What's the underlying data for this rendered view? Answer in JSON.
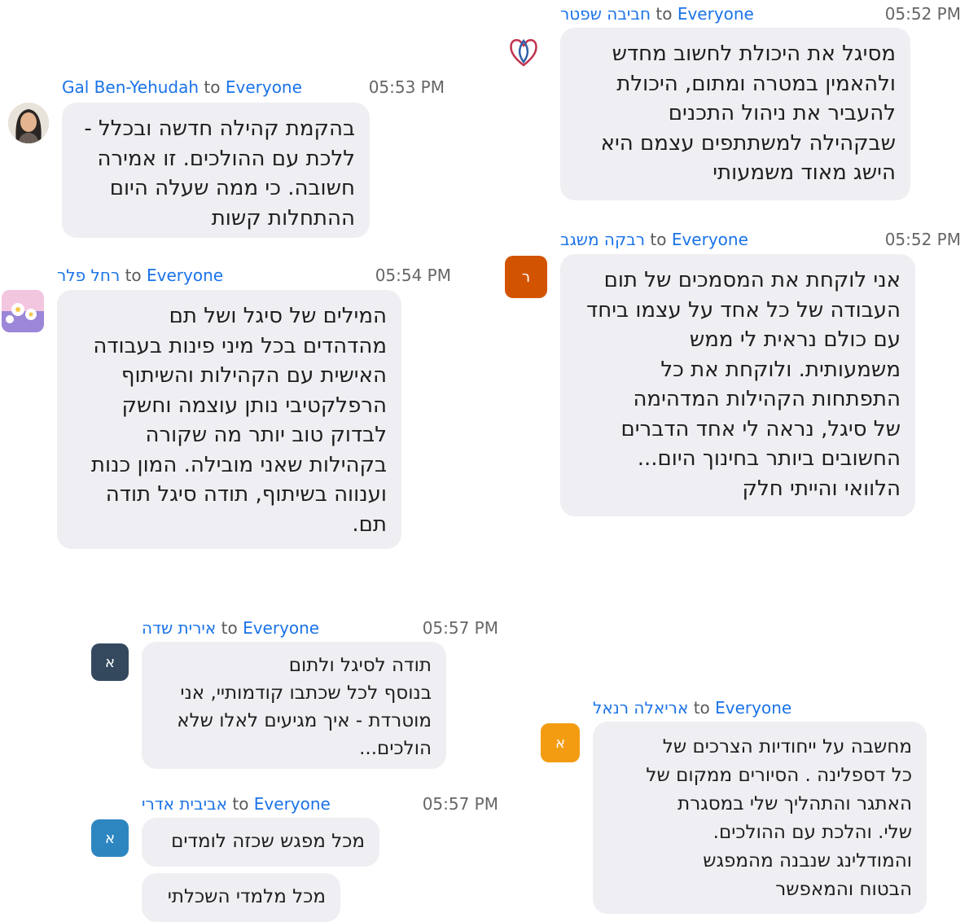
{
  "to_word": "to",
  "to_target": "Everyone",
  "messages": [
    {
      "sender": "חביבה שפטר",
      "time": "05:52 PM",
      "lines": [
        "מסיגל את היכולת לחשוב מחדש",
        "ולהאמין במטרה ומתום, היכולת",
        "להעביר את ניהול התכנים",
        "שבקהילה למשתתפים עצמם היא",
        "הישג מאוד משמעותי"
      ]
    },
    {
      "sender": "Gal Ben-Yehudah",
      "time": "05:53 PM",
      "lines": [
        "בהקמת קהילה חדשה ובכלל -",
        "ללכת עם ההולכים. זו אמירה",
        "חשובה. כי ממה שעלה היום",
        "ההתחלות קשות"
      ]
    },
    {
      "sender": "רבקה משגב",
      "time": "05:52 PM",
      "avatar_letter": "ר",
      "lines": [
        "אני לוקחת את המסמכים של תום",
        "העבודה של כל אחד על עצמו ביחד",
        "עם כולם נראית לי ממש",
        "משמעותית. ולוקחת את כל",
        "התפתחות הקהילות המדהימה",
        "של סיגל, נראה לי אחד הדברים",
        "החשובים ביותר בחינוך היום...",
        "הלוואי והייתי חלק"
      ]
    },
    {
      "sender": "רחל פלר",
      "time": "05:54 PM",
      "lines": [
        "המילים של סיגל ושל תם",
        "מהדהדים בכל מיני פינות בעבודה",
        "האישית עם הקהילות והשיתוף",
        "הרפלקטיבי נותן עוצמה וחשק",
        "לבדוק טוב יותר מה שקורה",
        "בקהילות שאני מובילה. המון כנות",
        "וענווה בשיתוף, תודה סיגל תודה",
        "תם."
      ]
    },
    {
      "sender": "אירית שדה",
      "time": "05:57 PM",
      "avatar_letter": "א",
      "lines": [
        "תודה לסיגל ולתום",
        "בנוסף לכל שכתבו קודמותיי, אני",
        "מוטרדת - איך מגיעים לאלו שלא",
        "הולכים..."
      ]
    },
    {
      "sender": "אביבית אדרי",
      "time": "05:57 PM",
      "avatar_letter": "א",
      "lines": [
        "מכל מפגש שכזה לומדים"
      ],
      "lines2": [
        "מכל מלמדי השכלתי"
      ]
    },
    {
      "sender": "אריאלה רנאל",
      "avatar_letter": "א",
      "lines": [
        "מחשבה על ייחודיות הצרכים של",
        "כל דספלינה . הסיורים ממקום של",
        "האתגר והתהליך שלי במסגרת",
        "שלי. והלכת עם ההולכים.",
        "והמודלינג שנבנה מהמפגש",
        "הבטוח והמאפשר"
      ]
    }
  ]
}
